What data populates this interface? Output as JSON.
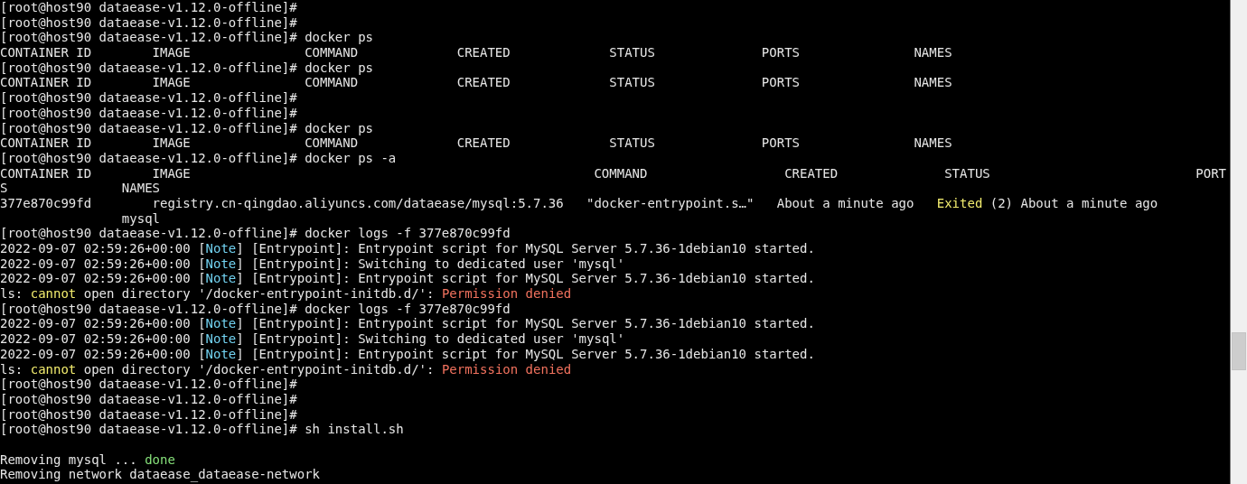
{
  "terminal": {
    "lines": [
      {
        "kind": "text",
        "segments": [
          {
            "text": "[root@host90 dataease-v1.12.0-offline]#",
            "kind": "plain"
          }
        ]
      },
      {
        "kind": "text",
        "segments": [
          {
            "text": "[root@host90 dataease-v1.12.0-offline]#",
            "kind": "plain"
          }
        ]
      },
      {
        "kind": "text",
        "segments": [
          {
            "text": "[root@host90 dataease-v1.12.0-offline]# docker ps",
            "kind": "plain"
          }
        ]
      },
      {
        "kind": "text",
        "segments": [
          {
            "text": "CONTAINER ID        IMAGE               COMMAND             CREATED             STATUS              PORTS               NAMES",
            "kind": "plain"
          }
        ]
      },
      {
        "kind": "text",
        "segments": [
          {
            "text": "[root@host90 dataease-v1.12.0-offline]# docker ps",
            "kind": "plain"
          }
        ]
      },
      {
        "kind": "text",
        "segments": [
          {
            "text": "CONTAINER ID        IMAGE               COMMAND             CREATED             STATUS              PORTS               NAMES",
            "kind": "plain"
          }
        ]
      },
      {
        "kind": "text",
        "segments": [
          {
            "text": "[root@host90 dataease-v1.12.0-offline]#",
            "kind": "plain"
          }
        ]
      },
      {
        "kind": "text",
        "segments": [
          {
            "text": "[root@host90 dataease-v1.12.0-offline]#",
            "kind": "plain"
          }
        ]
      },
      {
        "kind": "text",
        "segments": [
          {
            "text": "[root@host90 dataease-v1.12.0-offline]# docker ps",
            "kind": "plain"
          }
        ]
      },
      {
        "kind": "text",
        "segments": [
          {
            "text": "CONTAINER ID        IMAGE               COMMAND             CREATED             STATUS              PORTS               NAMES",
            "kind": "plain"
          }
        ]
      },
      {
        "kind": "text",
        "segments": [
          {
            "text": "[root@host90 dataease-v1.12.0-offline]# docker ps -a",
            "kind": "plain"
          }
        ]
      },
      {
        "kind": "text",
        "segments": [
          {
            "text": "CONTAINER ID        IMAGE                                                     COMMAND                  CREATED              STATUS                           PORT",
            "kind": "plain"
          }
        ]
      },
      {
        "kind": "text",
        "segments": [
          {
            "text": "S               NAMES",
            "kind": "plain"
          }
        ]
      },
      {
        "kind": "text",
        "segments": [
          {
            "text": "377e870c99fd        registry.cn-qingdao.aliyuncs.com/dataease/mysql:5.7.36   \"docker-entrypoint.s…\"   About a minute ago   ",
            "kind": "plain"
          },
          {
            "text": "Exited",
            "kind": "warning"
          },
          {
            "text": " (2) About a minute ago",
            "kind": "plain"
          }
        ]
      },
      {
        "kind": "text",
        "segments": [
          {
            "text": "                mysql",
            "kind": "plain"
          }
        ]
      },
      {
        "kind": "text",
        "segments": [
          {
            "text": "[root@host90 dataease-v1.12.0-offline]# docker logs -f 377e870c99fd",
            "kind": "plain"
          }
        ]
      },
      {
        "kind": "text",
        "segments": [
          {
            "text": "2022-09-07 02:59:26+00:00 [",
            "kind": "plain"
          },
          {
            "text": "Note",
            "kind": "note"
          },
          {
            "text": "] [Entrypoint]: Entrypoint script for MySQL Server 5.7.36-1debian10 started.",
            "kind": "plain"
          }
        ]
      },
      {
        "kind": "text",
        "segments": [
          {
            "text": "2022-09-07 02:59:26+00:00 [",
            "kind": "plain"
          },
          {
            "text": "Note",
            "kind": "note"
          },
          {
            "text": "] [Entrypoint]: Switching to dedicated user 'mysql'",
            "kind": "plain"
          }
        ]
      },
      {
        "kind": "text",
        "segments": [
          {
            "text": "2022-09-07 02:59:26+00:00 [",
            "kind": "plain"
          },
          {
            "text": "Note",
            "kind": "note"
          },
          {
            "text": "] [Entrypoint]: Entrypoint script for MySQL Server 5.7.36-1debian10 started.",
            "kind": "plain"
          }
        ]
      },
      {
        "kind": "text",
        "segments": [
          {
            "text": "ls: ",
            "kind": "plain"
          },
          {
            "text": "cannot",
            "kind": "warning"
          },
          {
            "text": " open directory '/docker-entrypoint-initdb.d/': ",
            "kind": "plain"
          },
          {
            "text": "Permission denied",
            "kind": "error"
          }
        ]
      },
      {
        "kind": "text",
        "segments": [
          {
            "text": "[root@host90 dataease-v1.12.0-offline]# docker logs -f 377e870c99fd",
            "kind": "plain"
          }
        ]
      },
      {
        "kind": "text",
        "segments": [
          {
            "text": "2022-09-07 02:59:26+00:00 [",
            "kind": "plain"
          },
          {
            "text": "Note",
            "kind": "note"
          },
          {
            "text": "] [Entrypoint]: Entrypoint script for MySQL Server 5.7.36-1debian10 started.",
            "kind": "plain"
          }
        ]
      },
      {
        "kind": "text",
        "segments": [
          {
            "text": "2022-09-07 02:59:26+00:00 [",
            "kind": "plain"
          },
          {
            "text": "Note",
            "kind": "note"
          },
          {
            "text": "] [Entrypoint]: Switching to dedicated user 'mysql'",
            "kind": "plain"
          }
        ]
      },
      {
        "kind": "text",
        "segments": [
          {
            "text": "2022-09-07 02:59:26+00:00 [",
            "kind": "plain"
          },
          {
            "text": "Note",
            "kind": "note"
          },
          {
            "text": "] [Entrypoint]: Entrypoint script for MySQL Server 5.7.36-1debian10 started.",
            "kind": "plain"
          }
        ]
      },
      {
        "kind": "text",
        "segments": [
          {
            "text": "ls: ",
            "kind": "plain"
          },
          {
            "text": "cannot",
            "kind": "warning"
          },
          {
            "text": " open directory '/docker-entrypoint-initdb.d/': ",
            "kind": "plain"
          },
          {
            "text": "Permission denied",
            "kind": "error"
          }
        ]
      },
      {
        "kind": "text",
        "segments": [
          {
            "text": "[root@host90 dataease-v1.12.0-offline]#",
            "kind": "plain"
          }
        ]
      },
      {
        "kind": "text",
        "segments": [
          {
            "text": "[root@host90 dataease-v1.12.0-offline]#",
            "kind": "plain"
          }
        ]
      },
      {
        "kind": "text",
        "segments": [
          {
            "text": "[root@host90 dataease-v1.12.0-offline]#",
            "kind": "plain"
          }
        ]
      },
      {
        "kind": "text",
        "segments": [
          {
            "text": "[root@host90 dataease-v1.12.0-offline]# sh install.sh",
            "kind": "plain"
          }
        ]
      },
      {
        "kind": "blank"
      },
      {
        "kind": "text",
        "segments": [
          {
            "text": "Removing mysql ... ",
            "kind": "plain"
          },
          {
            "text": "done",
            "kind": "success"
          }
        ]
      },
      {
        "kind": "text",
        "segments": [
          {
            "text": "Removing network dataease_dataease-network",
            "kind": "plain"
          }
        ]
      }
    ]
  }
}
